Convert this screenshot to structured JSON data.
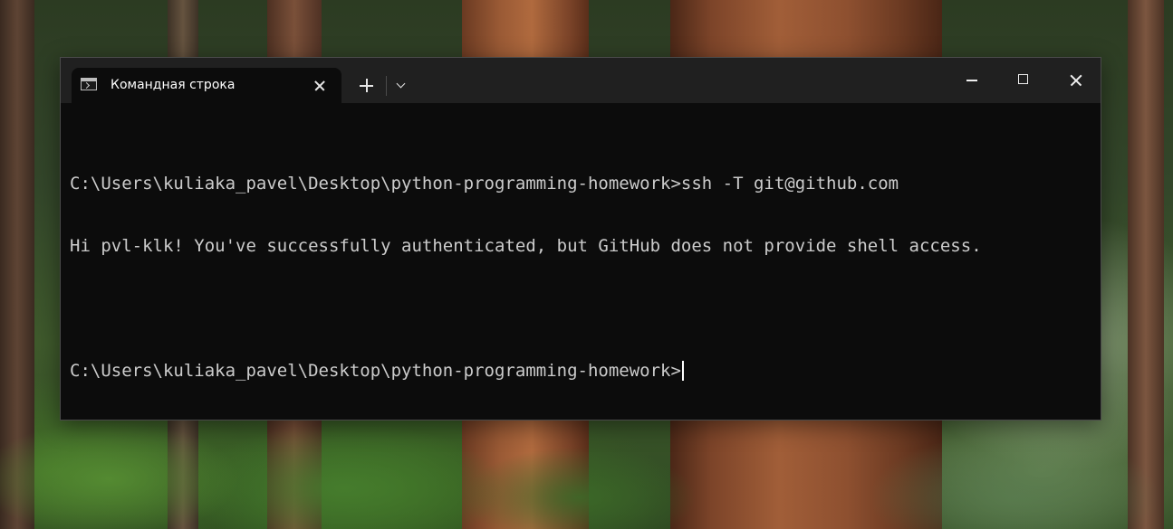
{
  "window": {
    "tab_title": "Командная строка",
    "tab_icon": "console-icon",
    "buttons": {
      "new_tab_icon": "plus-icon",
      "dropdown_icon": "chevron-down-icon",
      "minimize_icon": "minimize-icon",
      "maximize_icon": "maximize-icon",
      "close_icon": "close-icon"
    }
  },
  "console": {
    "lines": [
      "C:\\Users\\kuliaka_pavel\\Desktop\\python-programming-homework>ssh -T git@github.com",
      "Hi pvl-klk! You've successfully authenticated, but GitHub does not provide shell access.",
      "",
      "C:\\Users\\kuliaka_pavel\\Desktop\\python-programming-homework>"
    ]
  },
  "colors": {
    "console_bg": "#0c0c0c",
    "console_text": "#cccccc",
    "titlebar_bg": "#202020"
  }
}
